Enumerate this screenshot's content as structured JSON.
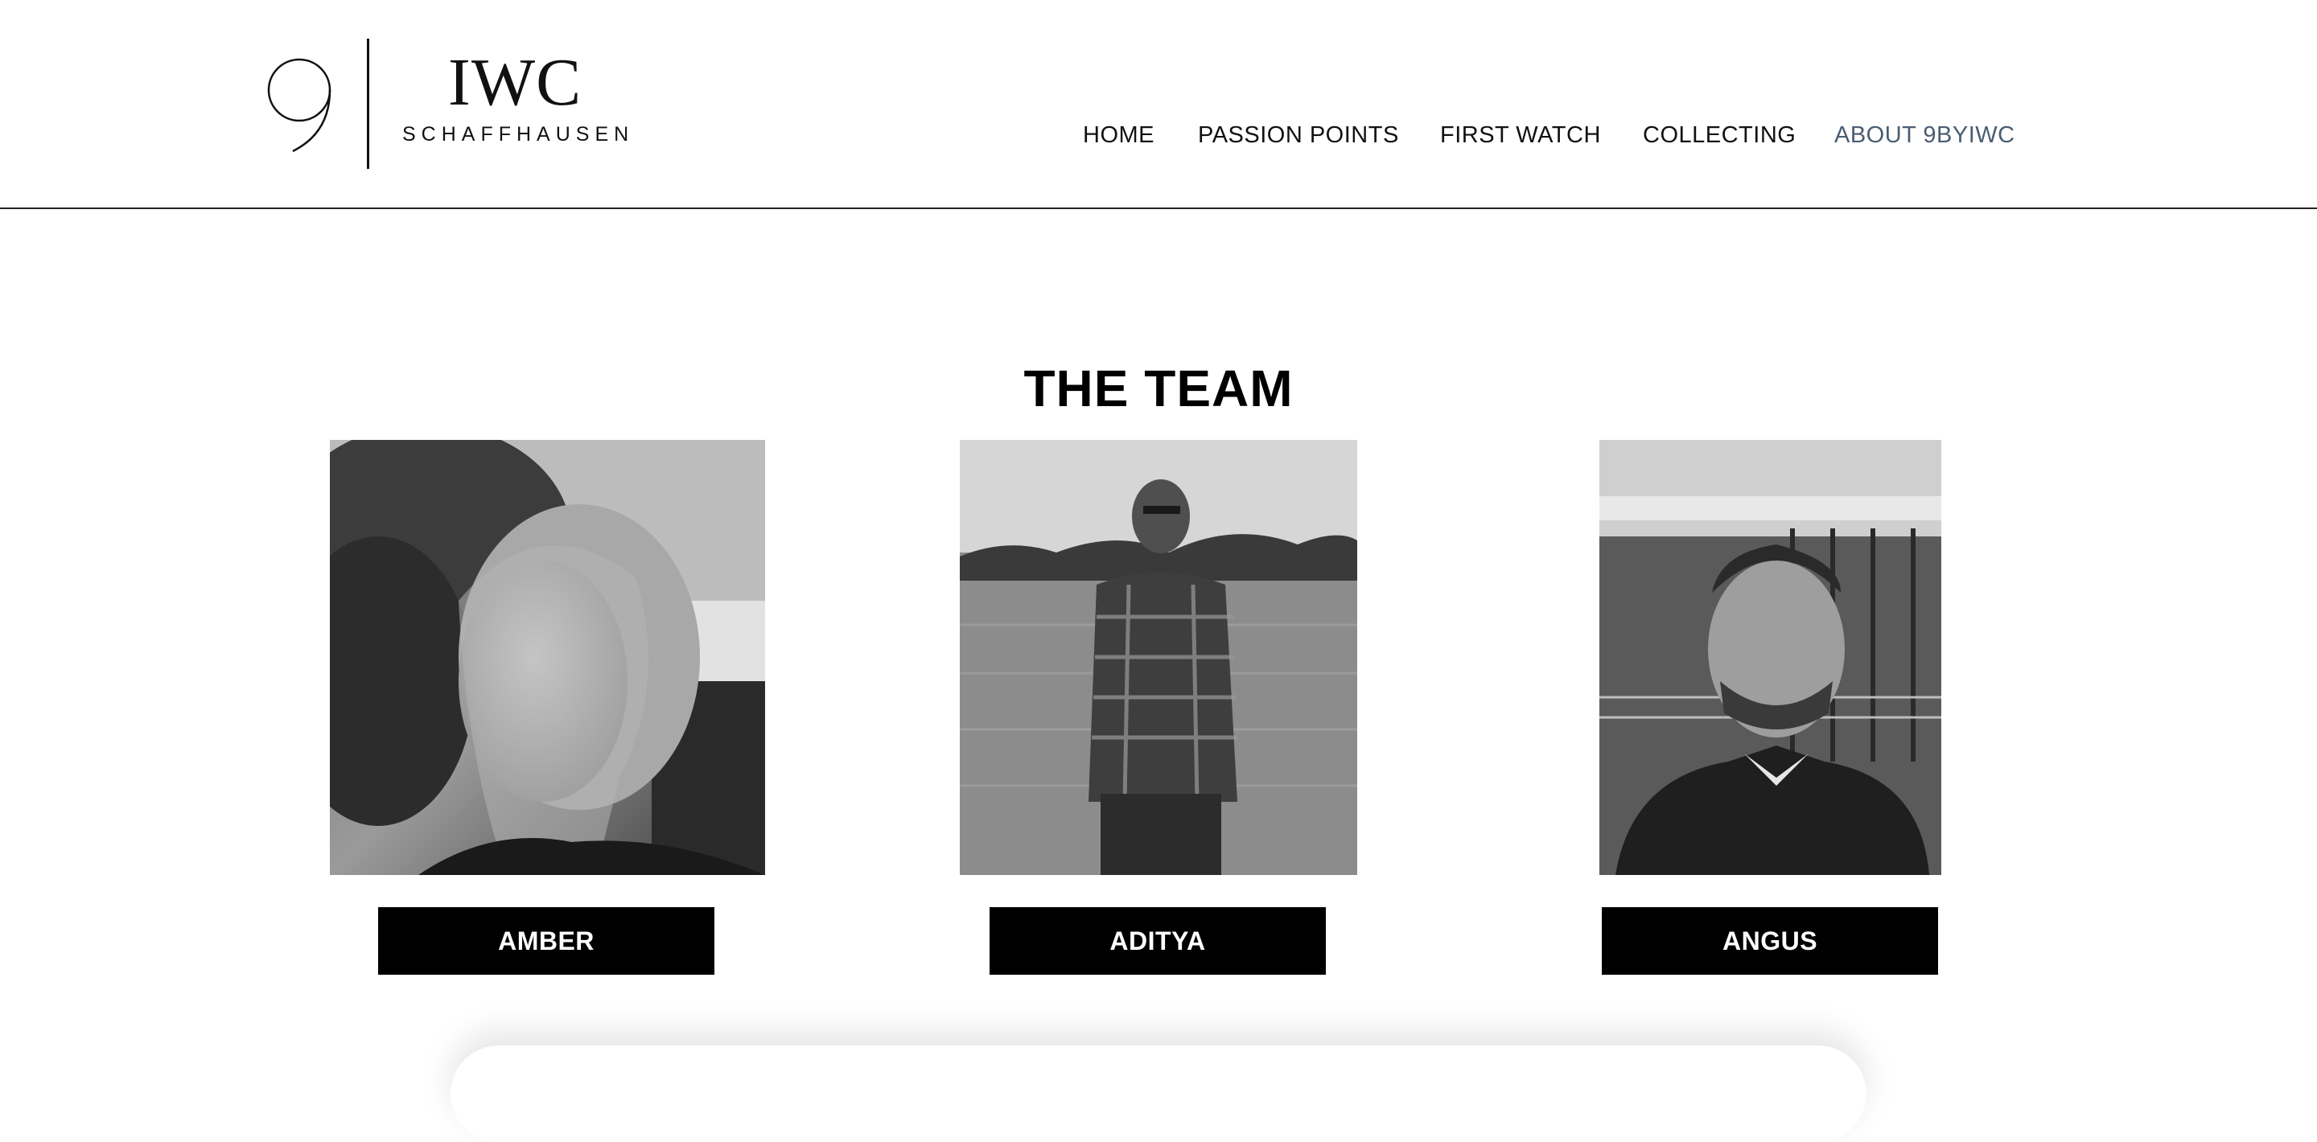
{
  "logo": {
    "brand": "IWC",
    "subtitle": "SCHAFFHAUSEN"
  },
  "nav": {
    "items": [
      {
        "label": "HOME",
        "active": false
      },
      {
        "label": "PASSION POINTS",
        "active": false
      },
      {
        "label": "FIRST WATCH",
        "active": false
      },
      {
        "label": "COLLECTING",
        "active": false
      },
      {
        "label": "ABOUT 9BYIWC",
        "active": true
      }
    ],
    "active_color": "#4a5d72"
  },
  "team": {
    "title": "THE TEAM",
    "members": [
      {
        "name": "AMBER",
        "photo": "amber-portrait-photo"
      },
      {
        "name": "ADITYA",
        "photo": "aditya-portrait-photo"
      },
      {
        "name": "ANGUS",
        "photo": "angus-portrait-photo"
      }
    ]
  }
}
